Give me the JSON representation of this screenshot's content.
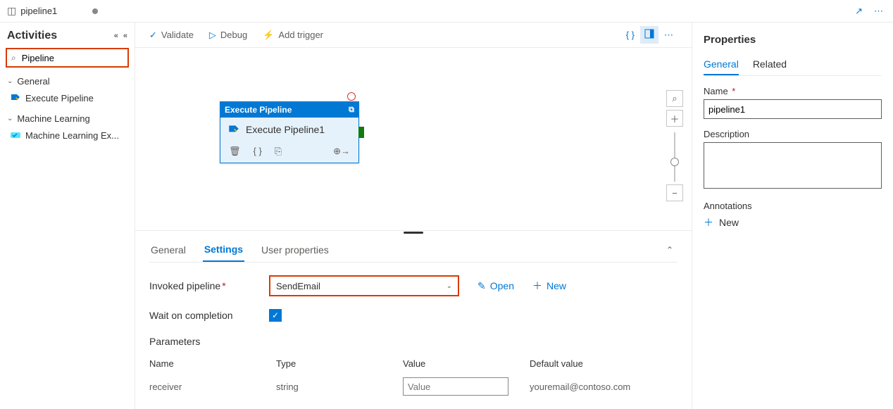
{
  "resource": {
    "name": "pipeline1"
  },
  "topBar": {
    "expand_icon": "↗",
    "more_icon": "⋯"
  },
  "activities": {
    "title": "Activities",
    "search_value": "Pipeline",
    "groups": [
      {
        "label": "General",
        "items": [
          {
            "label": "Execute Pipeline",
            "icon": "pipeline"
          }
        ]
      },
      {
        "label": "Machine Learning",
        "items": [
          {
            "label": "Machine Learning Ex...",
            "icon": "ml"
          }
        ]
      }
    ]
  },
  "toolbar": {
    "validate": "Validate",
    "debug": "Debug",
    "addTrigger": "Add trigger"
  },
  "canvas": {
    "node": {
      "type_label": "Execute Pipeline",
      "name": "Execute Pipeline1"
    }
  },
  "bottom": {
    "tabs": {
      "general": "General",
      "settings": "Settings",
      "userprops": "User properties"
    },
    "invoked_label": "Invoked pipeline",
    "invoked_value": "SendEmail",
    "open": "Open",
    "new": "New",
    "wait_label": "Wait on completion",
    "params_title": "Parameters",
    "param_headers": {
      "name": "Name",
      "type": "Type",
      "value": "Value",
      "default": "Default value"
    },
    "params": [
      {
        "name": "receiver",
        "type": "string",
        "value_placeholder": "Value",
        "default": "youremail@contoso.com"
      }
    ]
  },
  "props": {
    "title": "Properties",
    "tabs": {
      "general": "General",
      "related": "Related"
    },
    "name_label": "Name",
    "name_value": "pipeline1",
    "desc_label": "Description",
    "ann_label": "Annotations",
    "new": "New"
  }
}
